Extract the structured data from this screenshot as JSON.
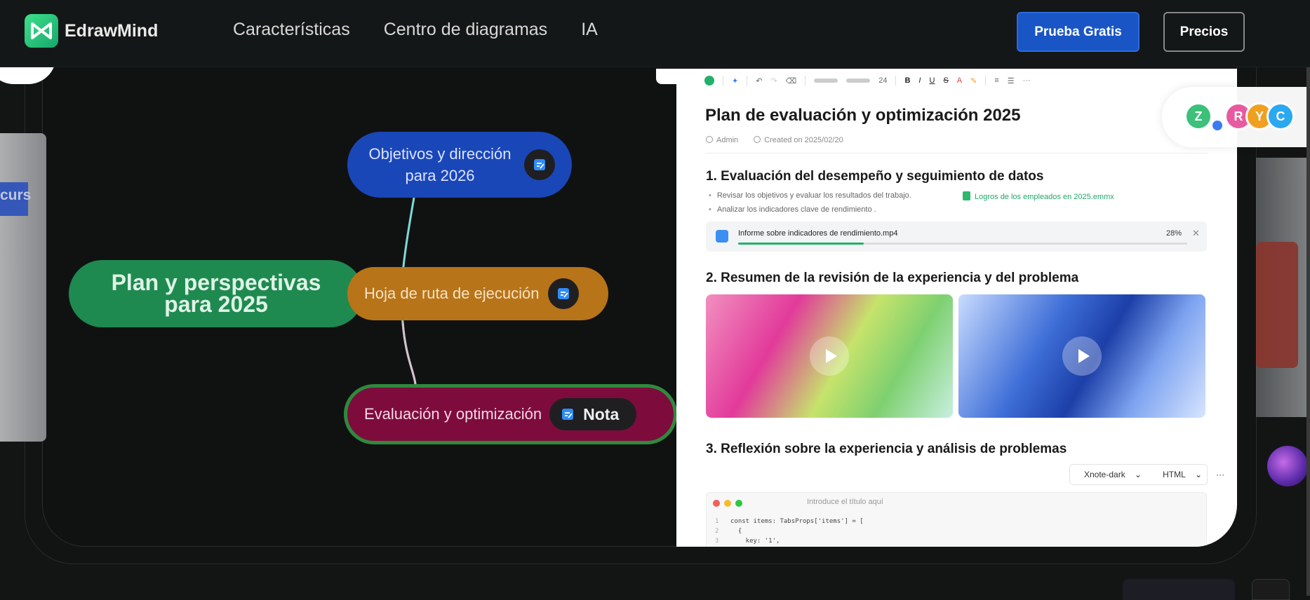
{
  "nav": {
    "brand": "EdrawMind",
    "links": [
      "Características",
      "Centro de diagramas",
      "IA"
    ],
    "trial_button": "Prueba Gratis",
    "prices_button": "Precios"
  },
  "left_panel_text": "curs",
  "mindmap": {
    "root": "Plan y perspectivas para 2025",
    "branches": [
      {
        "label": "Objetivos y dirección para 2026"
      },
      {
        "label": "Hoja de ruta de ejecución"
      },
      {
        "label": "Evaluación y optimización",
        "note": "Nota"
      }
    ]
  },
  "doc": {
    "toolbar_font_size": "24",
    "title": "Plan de evaluación y optimización 2025",
    "author": "Admin",
    "created": "Created on 2025/02/20",
    "sections": [
      {
        "heading": "1. Evaluación del desempeño y seguimiento de datos"
      },
      {
        "heading": "2. Resumen de la revisión de la experiencia y del problema"
      },
      {
        "heading": "3. Reflexión sobre la experiencia y análisis de problemas"
      }
    ],
    "bullets": [
      "Revisar los objetivos y evaluar los resultados del trabajo.",
      "Analizar los indicadores clave de rendimiento ."
    ],
    "attachment": "Logros de los empleados en 2025.emmx",
    "file": {
      "name": "Informe sobre indicadores de rendimiento.mp4",
      "percent_label": "28%",
      "progress": 0.28
    },
    "code": {
      "theme": "Xnote-dark",
      "language": "HTML",
      "more": "···",
      "title_placeholder": "Introduce el título aquí",
      "lines": [
        {
          "n": "1",
          "text": "const items: TabsProps['items'] = ["
        },
        {
          "n": "2",
          "text": "  {"
        },
        {
          "n": "3",
          "text": "    key: '1',"
        }
      ]
    }
  },
  "avatars": [
    {
      "letter": "Z",
      "color": "#3cc07a"
    },
    {
      "letter": "R",
      "color": "#e85aa0"
    },
    {
      "letter": "Y",
      "color": "#f0a020"
    },
    {
      "letter": "C",
      "color": "#2aa8f0"
    }
  ]
}
